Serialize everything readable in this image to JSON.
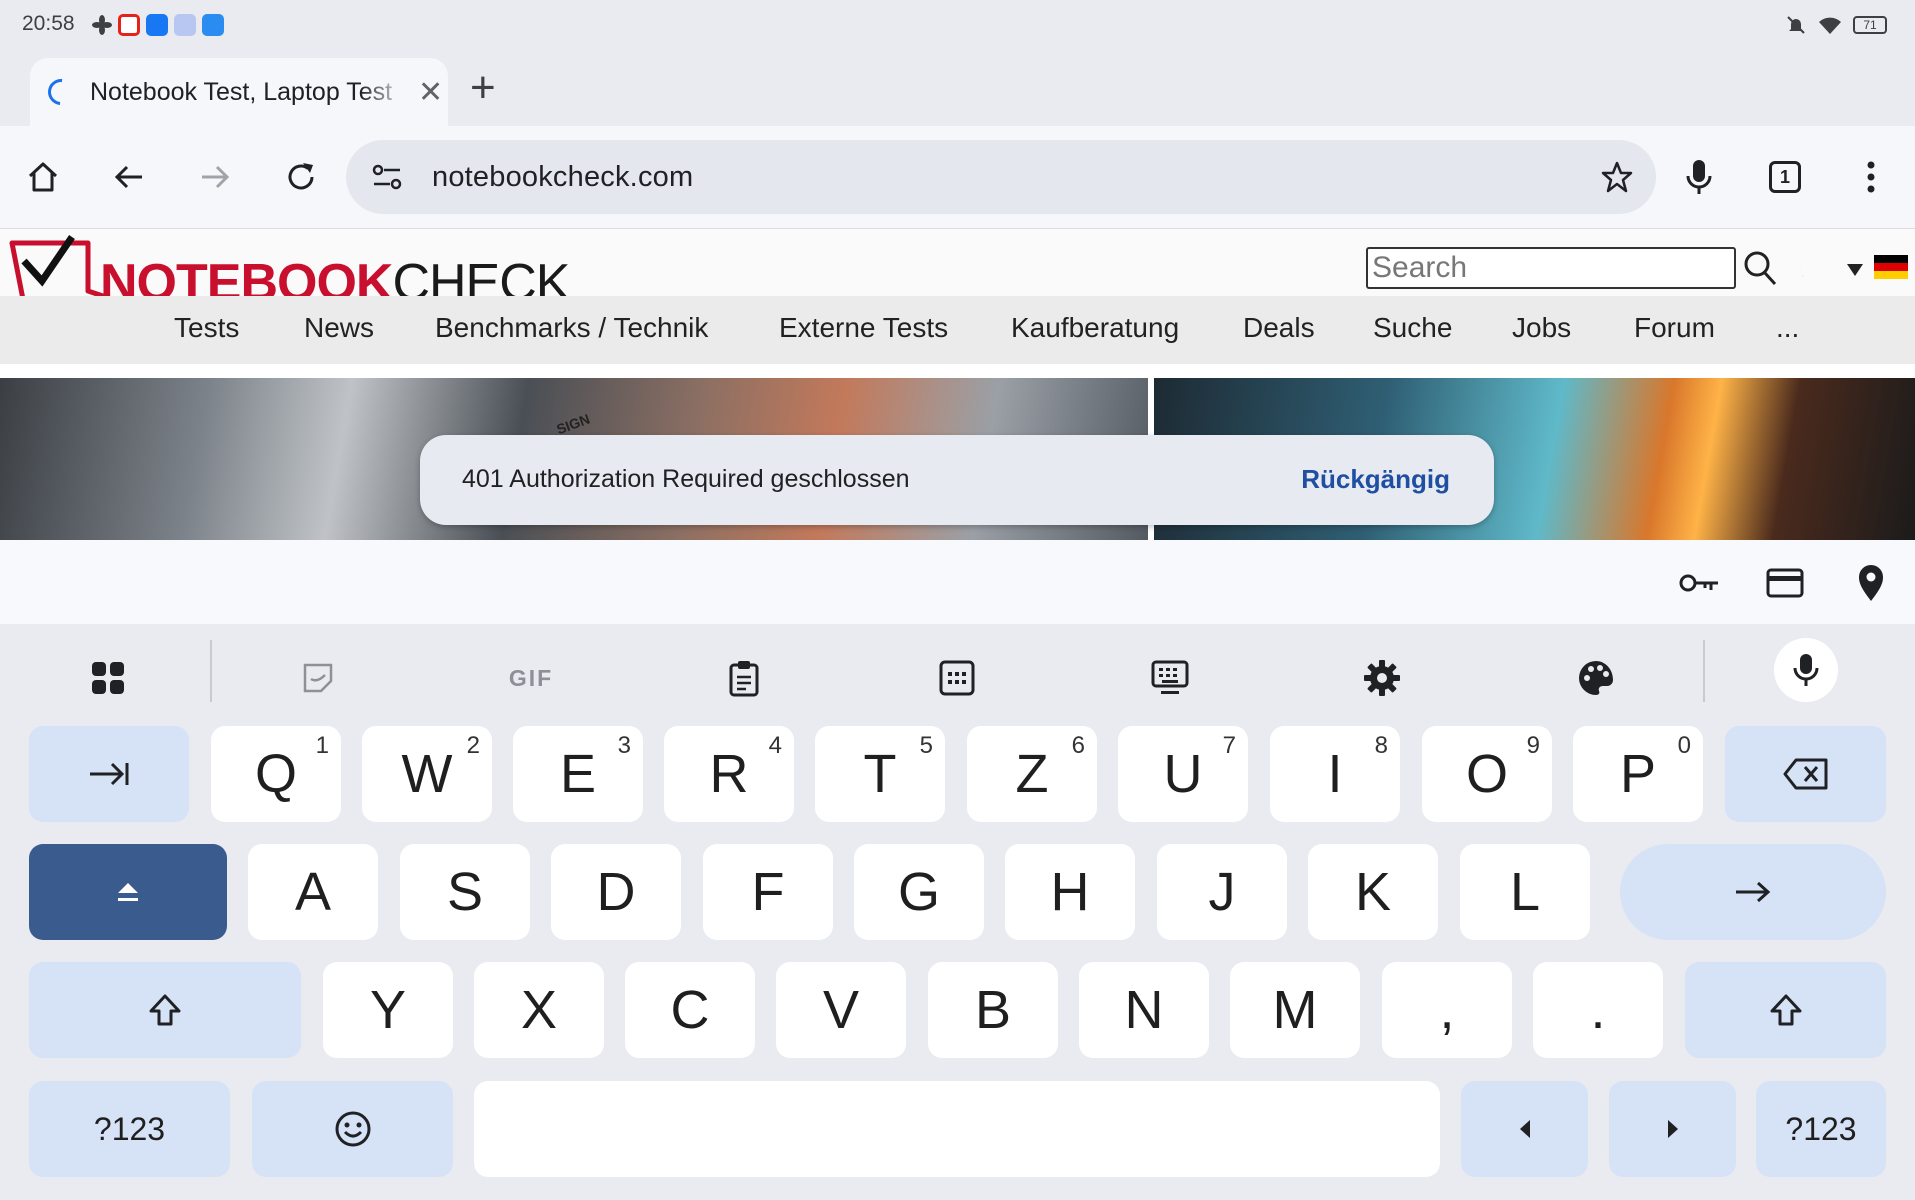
{
  "status": {
    "time": "20:58",
    "battery": "71"
  },
  "browser": {
    "tab": {
      "title": "Notebook Test, Laptop Test"
    },
    "omnibox": {
      "url": "notebookcheck.com"
    },
    "tab_count": "1"
  },
  "site": {
    "logo": {
      "part1": "NOTEBOOK",
      "part2": "CHECK"
    },
    "search_placeholder": "Search",
    "nav": [
      "Tests",
      "News",
      "Benchmarks / Technik",
      "Externe Tests",
      "Kaufberatung",
      "Deals",
      "Suche",
      "Jobs",
      "Forum",
      "..."
    ],
    "banner_text": "SIGN"
  },
  "snackbar": {
    "message": "401 Authorization Required geschlossen",
    "action": "Rückgängig"
  },
  "keyboard": {
    "toolbar_gif": "GIF",
    "row1": [
      {
        "l": "Q",
        "n": "1"
      },
      {
        "l": "W",
        "n": "2"
      },
      {
        "l": "E",
        "n": "3"
      },
      {
        "l": "R",
        "n": "4"
      },
      {
        "l": "T",
        "n": "5"
      },
      {
        "l": "Z",
        "n": "6"
      },
      {
        "l": "U",
        "n": "7"
      },
      {
        "l": "I",
        "n": "8"
      },
      {
        "l": "O",
        "n": "9"
      },
      {
        "l": "P",
        "n": "0"
      }
    ],
    "row2": [
      "A",
      "S",
      "D",
      "F",
      "G",
      "H",
      "J",
      "K",
      "L"
    ],
    "row3": [
      "Y",
      "X",
      "C",
      "V",
      "B",
      "N",
      "M",
      ",",
      "."
    ],
    "symbols_label": "?123"
  },
  "colors": {
    "accent": "#1a73e8",
    "brand_red": "#c8102e",
    "shift_active": "#3a5b8e",
    "func_key": "#d6e2f6"
  }
}
